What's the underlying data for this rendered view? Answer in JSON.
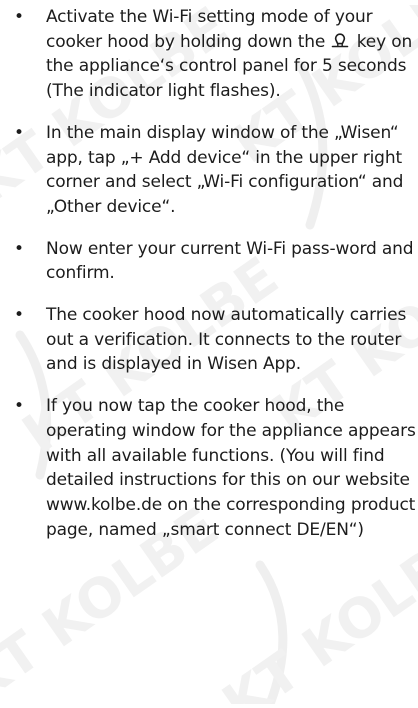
{
  "watermark": {
    "text": "KT KOLBE",
    "color": "#ececec"
  },
  "steps": [
    {
      "parts": [
        "Activate the  Wi-Fi setting mode of your cooker hood by holding down the ",
        " key on the appliance‘s control panel for 5 seconds (The indicator light flashes)."
      ],
      "icon": "light-bulb-icon"
    },
    {
      "text": "In the main display window of the „Wisen“ app, tap „+ Add device“ in the upper right corner and select „Wi-Fi configuration“ and „Other device“."
    },
    {
      "text": "Now enter your current Wi-Fi pass-word and confirm."
    },
    {
      "text": "The cooker hood now automatically carries out a verification. It connects to the router and is displayed in Wisen App."
    },
    {
      "text": "If you now tap the cooker hood, the operating window for the appliance appears with all available functions. (You will find detailed instructions for this on our website www.kolbe.de on the corresponding product page, named „smart connect DE/EN“)"
    }
  ]
}
